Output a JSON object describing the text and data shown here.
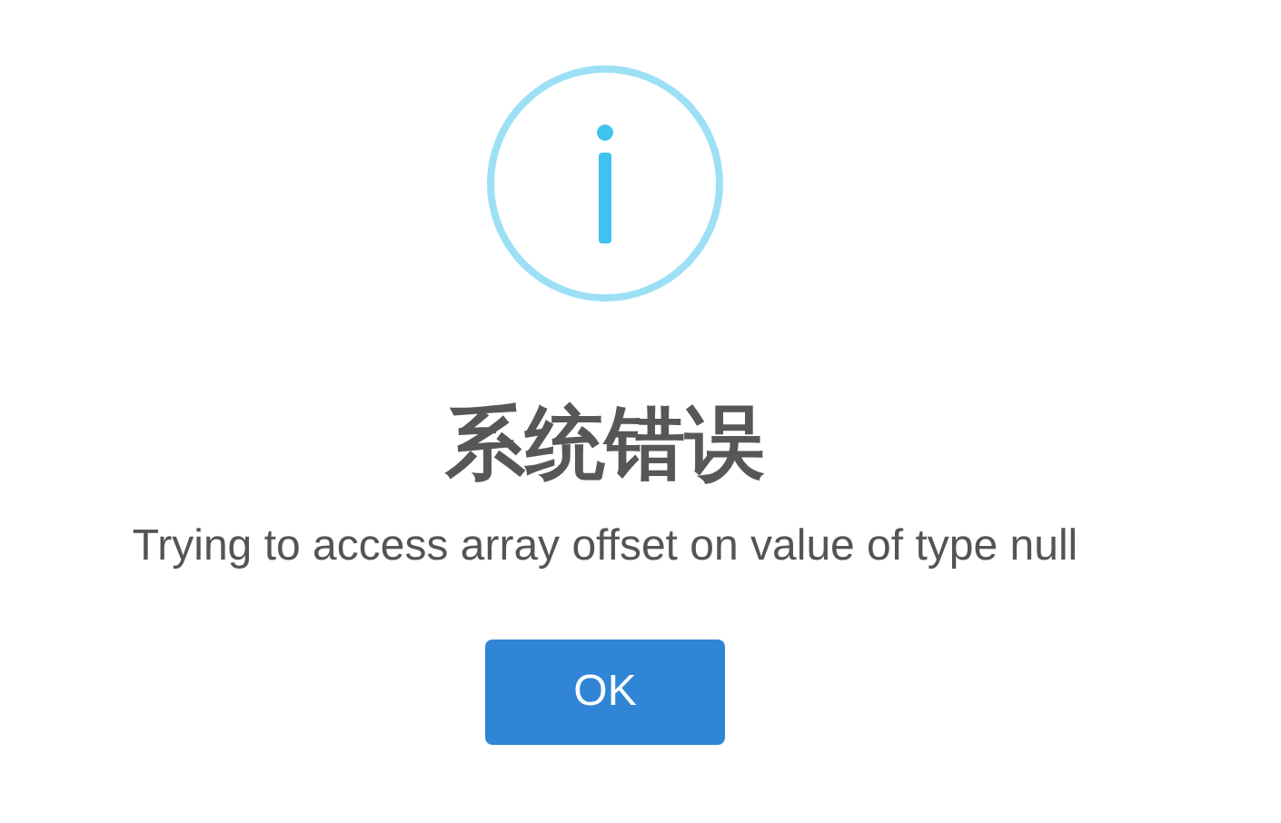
{
  "dialog": {
    "icon": {
      "kind": "info"
    },
    "title": "系统错误",
    "message": "Trying to access array offset on value of type null",
    "buttons": [
      {
        "label": "OK"
      }
    ]
  }
}
